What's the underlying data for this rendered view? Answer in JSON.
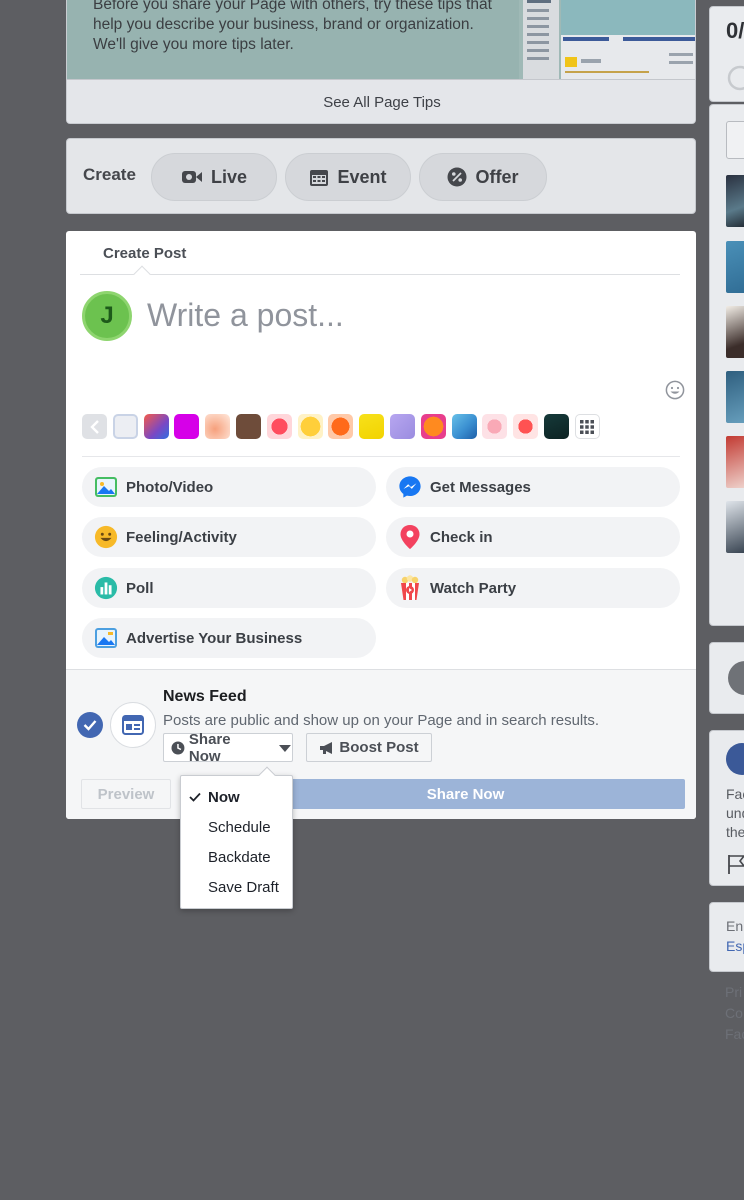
{
  "tips": {
    "lines": [
      "Before you share your Page with others, try these tips that",
      "help you describe your business, brand or organization.",
      "We'll give you more tips later."
    ],
    "link_label": "See All Page Tips"
  },
  "create_bar": {
    "label": "Create",
    "buttons": [
      {
        "label": "Live",
        "icon": "video-camera-icon"
      },
      {
        "label": "Event",
        "icon": "calendar-icon"
      },
      {
        "label": "Offer",
        "icon": "percent-badge-icon"
      }
    ]
  },
  "composer": {
    "tab_label": "Create Post",
    "avatar_letter": "J",
    "placeholder": "Write a post...",
    "background_swatches": [
      "#eceef3",
      "#7a48c4",
      "#d600e8",
      "#f6a07c",
      "#6e4c3a",
      "#ff4d5e",
      "#ffcf3a",
      "#ff6a1a",
      "#f7e11b",
      "#9a8ce0",
      "#ff8a1f",
      "#3a8fd1",
      "#f9a9b6",
      "#ff5252",
      "#163a3a"
    ],
    "actions": [
      {
        "label": "Photo/Video",
        "icon": "photo-icon"
      },
      {
        "label": "Feeling/Activity",
        "icon": "smiley-icon"
      },
      {
        "label": "Poll",
        "icon": "poll-icon"
      },
      {
        "label": "Advertise Your Business",
        "icon": "advertise-icon"
      },
      {
        "label": "Get Messages",
        "icon": "messenger-icon"
      },
      {
        "label": "Check in",
        "icon": "location-pin-icon"
      },
      {
        "label": "Watch Party",
        "icon": "popcorn-icon"
      }
    ]
  },
  "audience": {
    "title": "News Feed",
    "description": "Posts are public and show up on your Page and in search results.",
    "share_dropdown_label": "Share Now",
    "boost_label": "Boost Post",
    "preview_label": "Preview",
    "share_button_label": "Share Now"
  },
  "share_menu": {
    "items": [
      "Now",
      "Schedule",
      "Backdate",
      "Save Draft"
    ],
    "selected": "Now"
  },
  "right_rail": {
    "counter_text": "0/",
    "fb_text_lines": [
      "Fac",
      "und",
      "the"
    ],
    "language_lines": [
      "En",
      "Esp"
    ],
    "footer_lines": [
      "Pri",
      "Co",
      "Fac"
    ]
  },
  "colors": {
    "brand_blue": "#4267b2",
    "share_button_disabled": "#9cb4d8",
    "overlay": "#5d5e62"
  }
}
